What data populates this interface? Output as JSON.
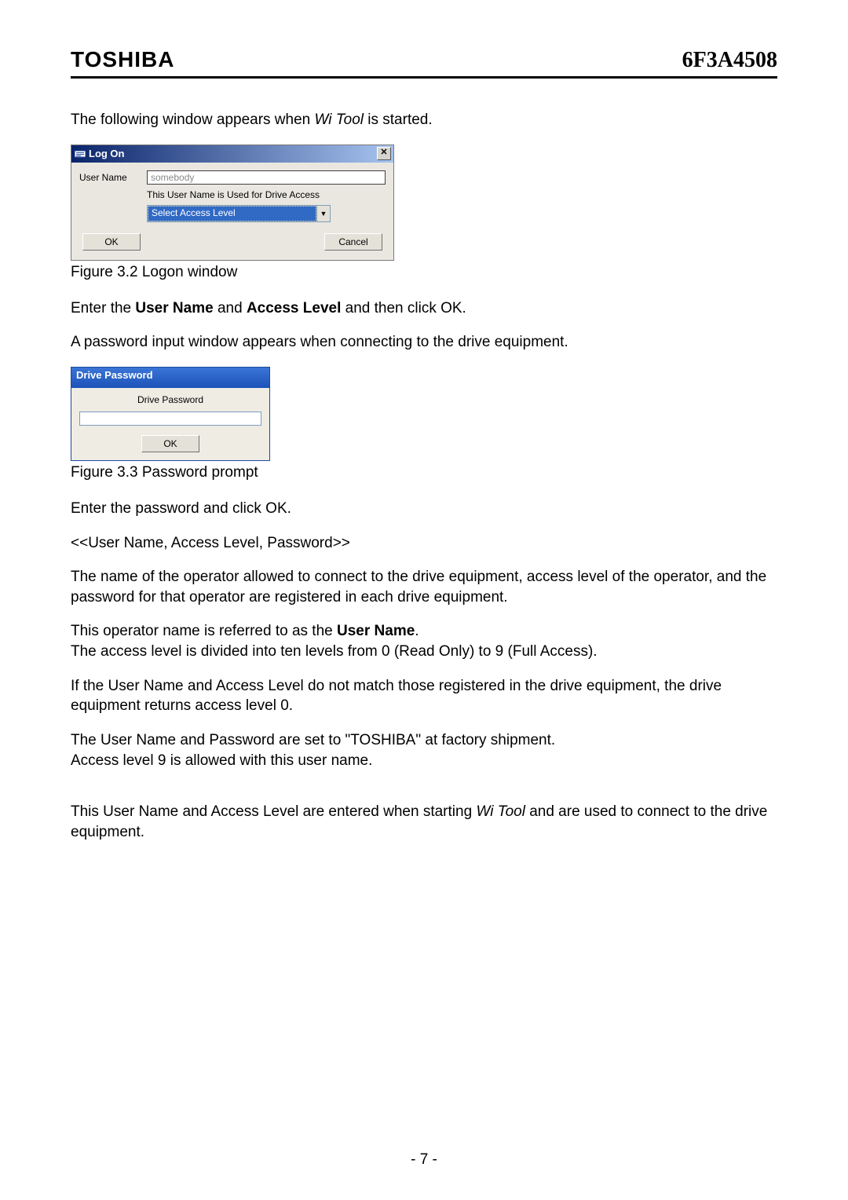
{
  "header": {
    "brand": "TOSHIBA",
    "doc_code": "6F3A4508"
  },
  "intro": {
    "prefix": "The following window appears when ",
    "tool_name": "Wi Tool",
    "suffix": " is started."
  },
  "logon_dialog": {
    "title": "Log On",
    "user_name_label": "User Name",
    "user_name_value": "somebody",
    "hint": "This User Name is Used for Drive Access",
    "access_level_placeholder": "Select Access Level",
    "ok_label": "OK",
    "cancel_label": "Cancel"
  },
  "figure32_caption": "Figure 3.2 Logon window",
  "enter_line": {
    "p1": "Enter the ",
    "b1": "User Name",
    "p2": " and ",
    "b2": "Access Level",
    "p3": " and then click OK."
  },
  "pwd_intro": "A password input window appears when connecting to the drive equipment.",
  "pwd_dialog": {
    "title": "Drive Password",
    "label": "Drive Password",
    "ok_label": "OK"
  },
  "figure33_caption": "Figure 3.3 Password prompt",
  "body": {
    "p_enter_pwd": "Enter the password and click OK.",
    "p_bracket": "<<User Name, Access Level, Password>>",
    "p_desc": "The name of the operator allowed to connect to the drive equipment, access level of the operator, and the password for that operator are registered in each drive equipment.",
    "p_user_name_line": {
      "p1": "This operator name is referred to as the ",
      "b1": "User Name",
      "p2": "."
    },
    "p_levels": "The access level is divided into ten levels from 0 (Read Only) to 9 (Full Access).",
    "p_mismatch": "If the User Name and Access Level do not match those registered in the drive equipment, the drive equipment returns access level 0.",
    "p_factory1": "The User Name and Password are set to \"TOSHIBA\" at factory shipment.",
    "p_factory2": "Access level 9 is allowed with this user name.",
    "p_final": {
      "p1": "This User Name and Access Level are entered when starting ",
      "i1": "Wi Tool",
      "p2": " and are used to connect to the drive equipment."
    }
  },
  "page_number": "- 7 -"
}
